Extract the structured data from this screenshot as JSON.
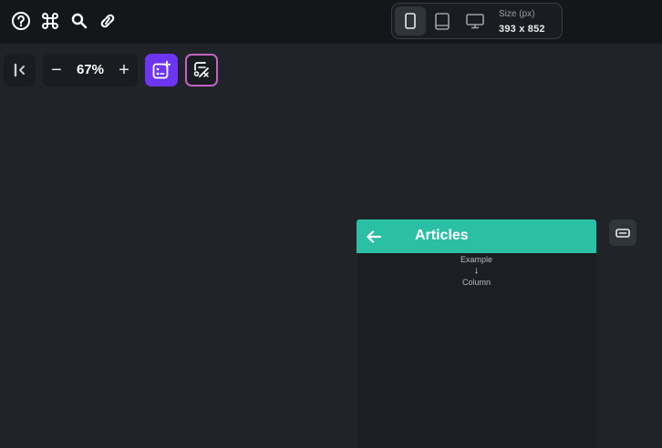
{
  "toolbar": {
    "icons": [
      "help-icon",
      "command-icon",
      "search-icon",
      "link-icon"
    ]
  },
  "device_selector": {
    "options": [
      "phone",
      "tablet",
      "desktop"
    ],
    "selected": "phone",
    "size_label": "Size (px)",
    "size_value": "393 x 852"
  },
  "zoom": {
    "value": "67%",
    "minus": "−",
    "plus": "+"
  },
  "canvas": {
    "appbar_title": "Articles",
    "placeholder_top": "Example",
    "placeholder_arrow": "↓",
    "placeholder_bottom": "Column",
    "accent_color": "#2bbfa5"
  },
  "colors": {
    "background": "#202428",
    "topbar": "#14171a",
    "add_button": "#6d35f2",
    "ai_button_border": "#c264c8"
  }
}
